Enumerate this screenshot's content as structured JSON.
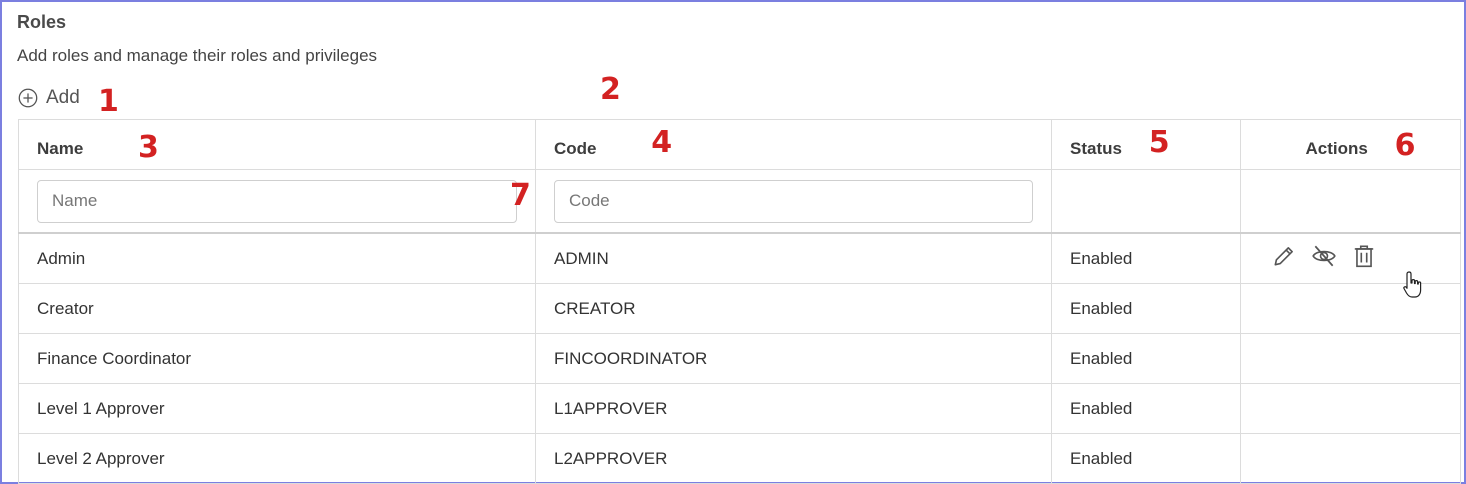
{
  "page": {
    "title": "Roles",
    "subtitle": "Add roles and manage their roles and privileges",
    "add_label": "Add"
  },
  "markers": [
    "1",
    "2",
    "3",
    "4",
    "5",
    "6",
    "7"
  ],
  "table": {
    "columns": [
      "Name",
      "Code",
      "Status",
      "Actions"
    ],
    "filters": {
      "name_placeholder": "Name",
      "code_placeholder": "Code"
    },
    "rows": [
      {
        "name": "Admin",
        "code": "ADMIN",
        "status": "Enabled"
      },
      {
        "name": "Creator",
        "code": "CREATOR",
        "status": "Enabled"
      },
      {
        "name": "Finance Coordinator",
        "code": "FINCOORDINATOR",
        "status": "Enabled"
      },
      {
        "name": "Level 1 Approver",
        "code": "L1APPROVER",
        "status": "Enabled"
      },
      {
        "name": "Level 2 Approver",
        "code": "L2APPROVER",
        "status": "Enabled"
      }
    ],
    "row_actions_icons": [
      "pencil-icon",
      "eye-off-icon",
      "trash-icon"
    ]
  },
  "colors": {
    "frame_border": "#7b7fe0",
    "marker": "#d32222",
    "grid_border": "#dcdcdc"
  }
}
